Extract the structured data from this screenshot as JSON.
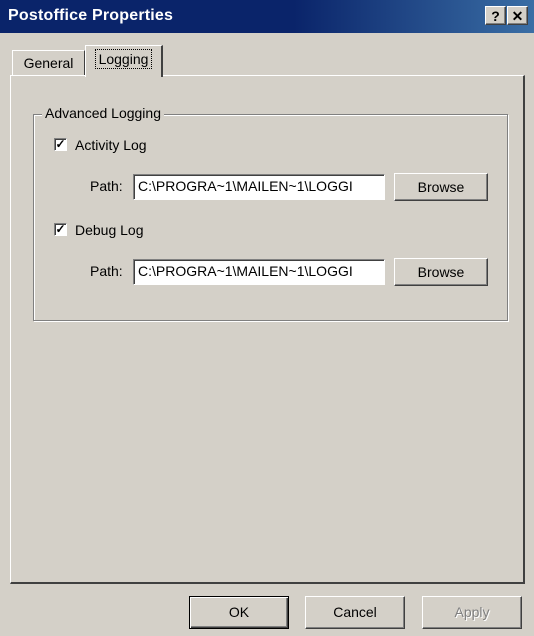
{
  "window": {
    "title": "Postoffice Properties",
    "help_glyph": "?",
    "close_glyph": "✕"
  },
  "tabs": [
    {
      "label": "General",
      "active": false
    },
    {
      "label": "Logging",
      "active": true
    }
  ],
  "advanced_logging": {
    "group_label": "Advanced Logging",
    "activity_log": {
      "label": "Activity Log",
      "checked": true,
      "path_label": "Path:",
      "path_value": "C:\\PROGRA~1\\MAILEN~1\\LOGGI",
      "browse_label": "Browse"
    },
    "debug_log": {
      "label": "Debug Log",
      "checked": true,
      "path_label": "Path:",
      "path_value": "C:\\PROGRA~1\\MAILEN~1\\LOGGI",
      "browse_label": "Browse"
    }
  },
  "footer": {
    "ok_label": "OK",
    "cancel_label": "Cancel",
    "apply_label": "Apply"
  },
  "check_glyph": "✓",
  "colors": {
    "titlebar": "#0a246a",
    "face": "#d4d0c8"
  }
}
